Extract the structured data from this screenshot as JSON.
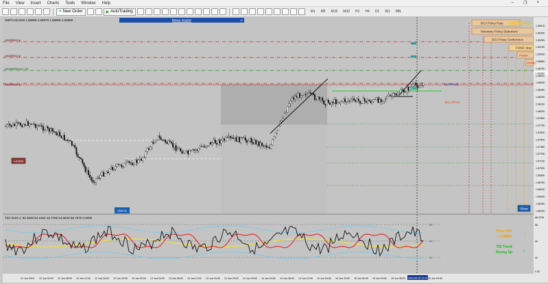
{
  "menu": [
    "File",
    "View",
    "Insert",
    "Charts",
    "Tools",
    "Window",
    "Help"
  ],
  "toolbar": {
    "new_order": "New Order",
    "auto_trading": "AutoTrading",
    "timeframes": [
      "M1",
      "M5",
      "M15",
      "M30",
      "H1",
      "H4",
      "D1",
      "W1",
      "MN"
    ]
  },
  "chart": {
    "header": "GBPCAD,M15  1.68969 1.68979 1.68969 1.68980",
    "news_reader": "News reader",
    "symbol_watermark": "GBPCAD",
    "show_button": "Show",
    "level_labels": [
      "#263998919 tp",
      "#263998910 tp",
      "#263998908 buy 1.93",
      "#263998904 sl"
    ],
    "badges": [
      "AMI 01",
      "1.67622"
    ],
    "events": [
      "BOJ Policy Rate",
      "Monetary Policy Statement",
      "BOJ Press Conference",
      "FOMC Mee",
      "Prelim",
      "Prelim"
    ],
    "buy_pivot": "BUY/Pivot",
    "sell_pivot": "SELL/Pivot",
    "price_labels": [
      "1.69515",
      "1.69390",
      "1.69255",
      "1.69130",
      "1.69005",
      "1.68880",
      "1.68755",
      "1.68630",
      "1.68505",
      "1.68380",
      "1.68255",
      "1.68130",
      "1.68005",
      "1.67880",
      "1.67755",
      "1.67630",
      "1.67505",
      "1.67380",
      "1.67255",
      "1.67130",
      "1.67005",
      "1.66880",
      "1.66755",
      "1.66630",
      "1.66505",
      "1.66380",
      "1.66255"
    ],
    "current_price": "1.68980",
    "time_labels": [
      "12 Jun 2023",
      "12 Jun 04:00",
      "12 Jun 08:00",
      "12 Jun 12:00",
      "12 Jun 16:00",
      "12 Jun 20:00",
      "13 Jun 00:00",
      "13 Jun 04:00",
      "13 Jun 08:00",
      "13 Jun 12:00",
      "13 Jun 16:00",
      "13 Jun 20:00",
      "14 Jun 00:00",
      "14 Jun 04:00",
      "14 Jun 08:00",
      "14 Jun 12:00",
      "14 Jun 16:00",
      "14 Jun 20:00",
      "15 Jun 00:00",
      "15 Jun 04:00",
      "15 Jun 08:00",
      "15 Jun 12:00",
      "15 Jun 16:00"
    ],
    "time_highlight": "2023.06.15 12:15"
  },
  "indicator": {
    "header": "TDI Alerts v: 84.3660 54.1663 43.7706 54.6849 58.7675 0.0000",
    "scale": [
      "88.2236",
      "68",
      "50",
      "32",
      "0.00"
    ],
    "panel_labels": [
      "68",
      "50",
      "32"
    ],
    "mean_title": "Mean Sell",
    "mean_value": "1.1.68880",
    "trend_title": "TDI Trend",
    "trend_value": "Strong Up"
  },
  "colors": {
    "chart_bg": "#c4c4c4",
    "red_line": "#e02020",
    "green_line": "#00b000",
    "rsi_line": "#111111",
    "signal_red": "#e03030",
    "signal_yellow": "#f0e040",
    "band_blue": "#70c8e8",
    "orange": "#f0a000"
  }
}
